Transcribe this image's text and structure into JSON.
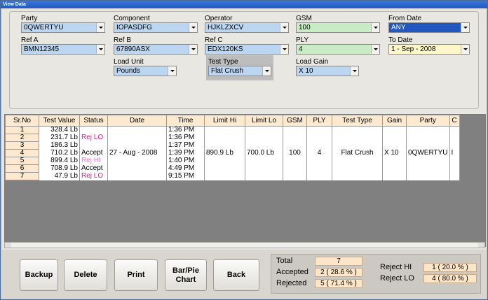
{
  "title": "View Data",
  "filters": {
    "party": {
      "label": "Party",
      "value": "0QWERTYU"
    },
    "component": {
      "label": "Component",
      "value": "IOPASDFG"
    },
    "operator": {
      "label": "Operator",
      "value": "HJKLZXCV"
    },
    "gsm": {
      "label": "GSM",
      "value": "100"
    },
    "from_date": {
      "label": "From Date",
      "value": "ANY"
    },
    "ref_a": {
      "label": "Ref A",
      "value": "BMN12345"
    },
    "ref_b": {
      "label": "Ref B",
      "value": "67890ASX"
    },
    "ref_c": {
      "label": "Ref C",
      "value": "EDX120KS"
    },
    "ply": {
      "label": "PLY",
      "value": "4"
    },
    "to_date": {
      "label": "To Date",
      "value": "1 - Sep - 2008"
    },
    "load_unit": {
      "label": "Load Unit",
      "value": "Pounds"
    },
    "test_type": {
      "label": "Test Type",
      "value": "Flat Crush"
    },
    "load_gain": {
      "label": "Load Gain",
      "value": "X 10"
    }
  },
  "table": {
    "headers": [
      "Sr.No",
      "Test Value",
      "Status",
      "Date",
      "Time",
      "Limit Hi",
      "Limit Lo",
      "GSM",
      "PLY",
      "Test Type",
      "Gain",
      "Party",
      "C"
    ],
    "rows": [
      {
        "sr": "1",
        "value": "328.4  Lb",
        "status": "",
        "date": "",
        "time": "1:36 PM"
      },
      {
        "sr": "2",
        "value": "231.7  Lb",
        "status": "Rej LO",
        "date": "",
        "time": "1:36 PM"
      },
      {
        "sr": "3",
        "value": "186.3  Lb",
        "status": "",
        "date": "",
        "time": "1:37 PM"
      },
      {
        "sr": "4",
        "value": "710.2  Lb",
        "status": "Accept",
        "date": "27 - Aug - 2008",
        "time": "1:39 PM",
        "limit_hi": "890.9  Lb",
        "limit_lo": "700.0  Lb",
        "gsm": "100",
        "ply": "4",
        "test_type": "Flat Crush",
        "gain": "X 10",
        "party": "0QWERTYU",
        "c": "I"
      },
      {
        "sr": "5",
        "value": "899.4  Lb",
        "status": "Rej HI",
        "date": "",
        "time": "1:40 PM"
      },
      {
        "sr": "6",
        "value": "708.9  Lb",
        "status": "Accept",
        "date": "",
        "time": "4:49 PM"
      },
      {
        "sr": "7",
        "value": "47.9  Lb",
        "status": "Rej LO",
        "date": "",
        "time": "9:15 PM"
      }
    ]
  },
  "buttons": {
    "backup": "Backup",
    "delete": "Delete",
    "print": "Print",
    "chart": "Bar/Pie Chart",
    "back": "Back"
  },
  "stats": {
    "total_label": "Total",
    "total": "7",
    "accepted_label": "Accepted",
    "accepted": "2 ( 28.6 % )",
    "rejected_label": "Rejected",
    "rejected": "5 ( 71.4 % )",
    "reject_hi_label": "Reject HI",
    "reject_hi": "1 ( 20.0 % )",
    "reject_lo_label": "Reject LO",
    "reject_lo": "4 ( 80.0 % )"
  }
}
